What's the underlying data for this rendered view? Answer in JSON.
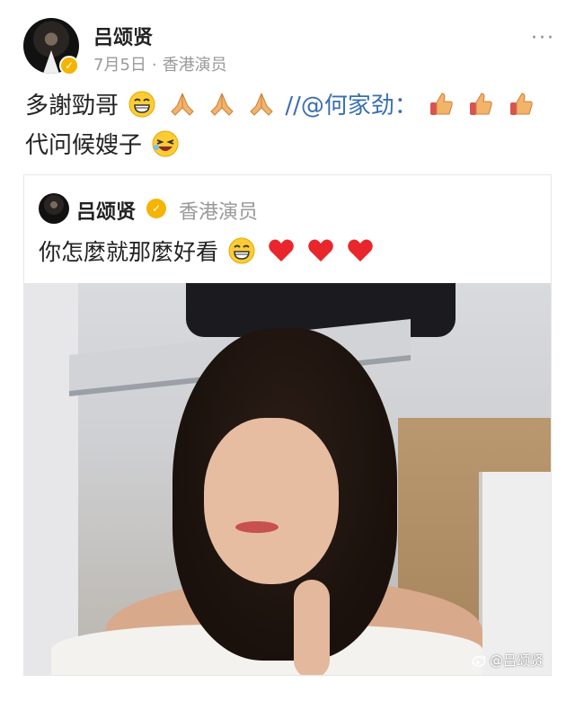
{
  "post": {
    "author_name": "吕颂贤",
    "date": "7月5日",
    "separator": "·",
    "author_title": "香港演员",
    "more_label": "···",
    "text_before": "多謝勁哥",
    "mention_text": "//@何家劲：",
    "line2_text": "代问候嫂子"
  },
  "repost": {
    "author_name": "吕颂贤",
    "author_title": "香港演员",
    "text": "你怎麼就那麼好看"
  },
  "watermark": {
    "text": "@吕颂贤"
  },
  "colors": {
    "mention": "#3a6fb0",
    "verified": "#f5b400",
    "meta": "#999999"
  },
  "icons": [
    "more-icon",
    "verified-icon",
    "grin-emoji",
    "praying-hands-emoji",
    "thumbs-up-emoji",
    "laughing-emoji",
    "heart-emoji",
    "weibo-icon"
  ]
}
